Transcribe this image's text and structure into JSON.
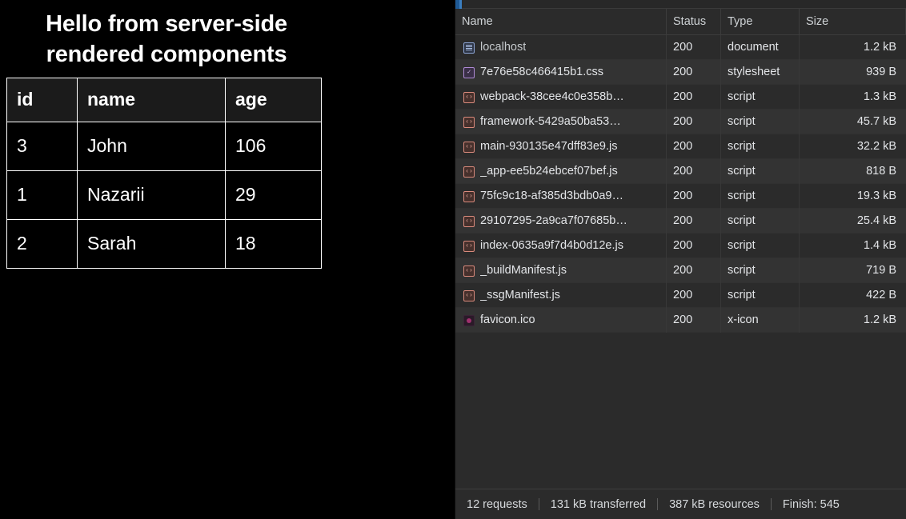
{
  "page": {
    "heading": "Hello from server-side rendered components",
    "table": {
      "columns": [
        "id",
        "name",
        "age"
      ],
      "rows": [
        {
          "id": "3",
          "name": "John",
          "age": "106"
        },
        {
          "id": "1",
          "name": "Nazarii",
          "age": "29"
        },
        {
          "id": "2",
          "name": "Sarah",
          "age": "18"
        }
      ]
    }
  },
  "devtools": {
    "panel": "Network",
    "columns": {
      "name": "Name",
      "status": "Status",
      "type": "Type",
      "size": "Size"
    },
    "requests": [
      {
        "name": "localhost",
        "status": "200",
        "type": "document",
        "size": "1.2 kB",
        "icon": "document-icon",
        "icon_kind": "doc"
      },
      {
        "name": "7e76e58c466415b1.css",
        "status": "200",
        "type": "stylesheet",
        "size": "939 B",
        "icon": "stylesheet-icon",
        "icon_kind": "css"
      },
      {
        "name": "webpack-38cee4c0e358b…",
        "status": "200",
        "type": "script",
        "size": "1.3 kB",
        "icon": "script-icon",
        "icon_kind": "js"
      },
      {
        "name": "framework-5429a50ba53…",
        "status": "200",
        "type": "script",
        "size": "45.7 kB",
        "icon": "script-icon",
        "icon_kind": "js"
      },
      {
        "name": "main-930135e47dff83e9.js",
        "status": "200",
        "type": "script",
        "size": "32.2 kB",
        "icon": "script-icon",
        "icon_kind": "js"
      },
      {
        "name": "_app-ee5b24ebcef07bef.js",
        "status": "200",
        "type": "script",
        "size": "818 B",
        "icon": "script-icon",
        "icon_kind": "js"
      },
      {
        "name": "75fc9c18-af385d3bdb0a9…",
        "status": "200",
        "type": "script",
        "size": "19.3 kB",
        "icon": "script-icon",
        "icon_kind": "js"
      },
      {
        "name": "29107295-2a9ca7f07685b…",
        "status": "200",
        "type": "script",
        "size": "25.4 kB",
        "icon": "script-icon",
        "icon_kind": "js"
      },
      {
        "name": "index-0635a9f7d4b0d12e.js",
        "status": "200",
        "type": "script",
        "size": "1.4 kB",
        "icon": "script-icon",
        "icon_kind": "js"
      },
      {
        "name": "_buildManifest.js",
        "status": "200",
        "type": "script",
        "size": "719 B",
        "icon": "script-icon",
        "icon_kind": "js"
      },
      {
        "name": "_ssgManifest.js",
        "status": "200",
        "type": "script",
        "size": "422 B",
        "icon": "script-icon",
        "icon_kind": "js"
      },
      {
        "name": "favicon.ico",
        "status": "200",
        "type": "x-icon",
        "size": "1.2 kB",
        "icon": "favicon-icon",
        "icon_kind": "ico"
      }
    ],
    "summary": {
      "requests": "12 requests",
      "transferred": "131 kB transferred",
      "resources": "387 kB resources",
      "finish": "Finish: 545 "
    }
  },
  "colors": {
    "page_background": "#000000",
    "page_text": "#ffffff",
    "devtools_background": "#2b2b2b",
    "devtools_row_alt": "#333333",
    "devtools_text": "#e3e5e8",
    "icon_script": "#d98a7c",
    "icon_stylesheet": "#b08bd6",
    "icon_document": "#8ea6d6",
    "overview_marker": "#1f5a96"
  }
}
